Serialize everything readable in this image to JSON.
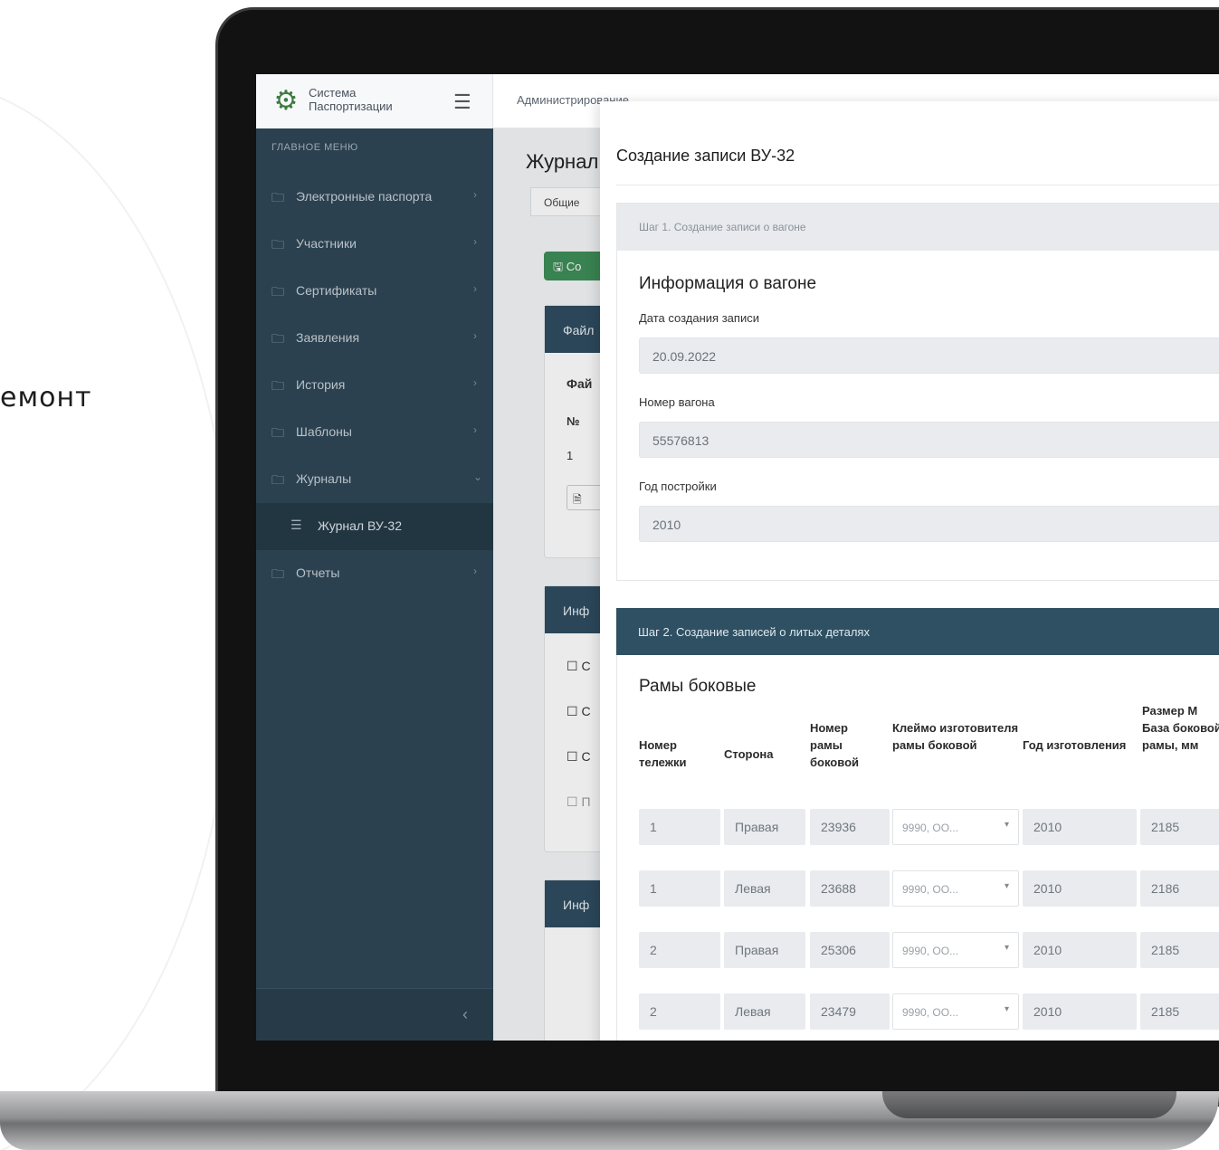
{
  "bg_text": "емонт",
  "app": {
    "logo_line1": "Система",
    "logo_line2": "Паспортизации",
    "breadcrumb": "Администрирование"
  },
  "sidebar": {
    "heading": "ГЛАВНОЕ МЕНЮ",
    "items": [
      {
        "label": "Электронные паспорта"
      },
      {
        "label": "Участники"
      },
      {
        "label": "Сертификаты"
      },
      {
        "label": "Заявления"
      },
      {
        "label": "История"
      },
      {
        "label": "Шаблоны"
      },
      {
        "label": "Журналы"
      },
      {
        "label": "Журнал ВУ-32"
      },
      {
        "label": "Отчеты"
      }
    ]
  },
  "main": {
    "title": "Журнал",
    "tab": "Общие",
    "button": "Со",
    "card1_head": "Файл",
    "card1_sub": "Фай",
    "col_num": "№",
    "row_num": "1",
    "card2_head": "Инф",
    "checkbox_labels": [
      "С",
      "С",
      "С",
      "П"
    ],
    "card3_head": "Инф"
  },
  "modal": {
    "title": "Создание записи ВУ-32",
    "step1": {
      "header": "Шаг 1. Создание записи о вагоне",
      "section": "Информация о вагоне",
      "date_label": "Дата создания записи",
      "date_value": "20.09.2022",
      "wagon_label": "Номер вагона",
      "wagon_value": "55576813",
      "year_label": "Год постройки",
      "year_value": "2010"
    },
    "step2": {
      "header": "Шаг 2. Создание записей о литых деталях",
      "section": "Рамы боковые",
      "columns": [
        "Номер тележки",
        "Сторона",
        "Номер рамы боковой",
        "Клеймо изготовителя рамы боковой",
        "Год изготовления",
        "Размер М База боковой рамы, мм"
      ],
      "rows": [
        [
          "1",
          "Правая",
          "23936",
          "9990, ОО...",
          "2010",
          "2185"
        ],
        [
          "1",
          "Левая",
          "23688",
          "9990, ОО...",
          "2010",
          "2186"
        ],
        [
          "2",
          "Правая",
          "25306",
          "9990, ОО...",
          "2010",
          "2185"
        ],
        [
          "2",
          "Левая",
          "23479",
          "9990, ОО...",
          "2010",
          "2185"
        ]
      ]
    }
  }
}
